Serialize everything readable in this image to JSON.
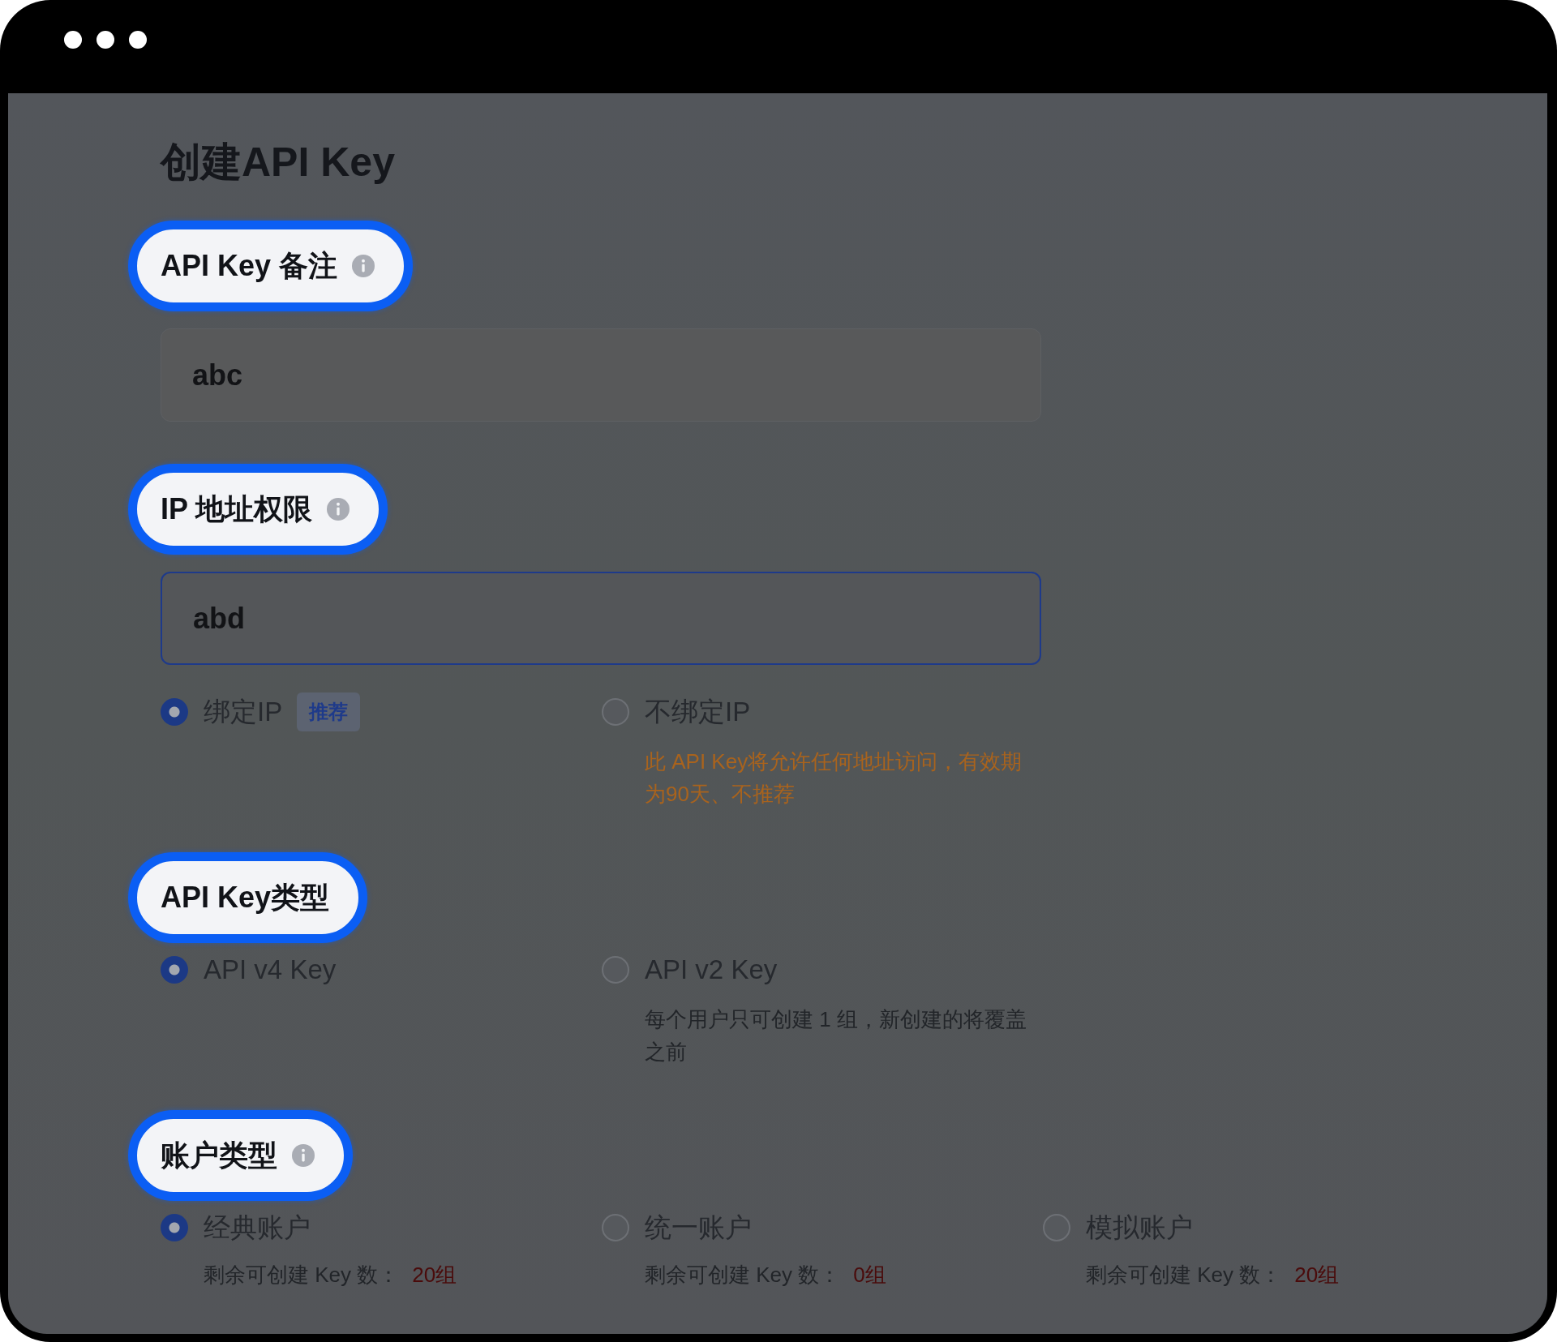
{
  "page": {
    "title": "创建API Key"
  },
  "sections": [
    {
      "label": {
        "text": "API Key 备注",
        "highlighted": true,
        "info": true
      },
      "field": {
        "value": "abc",
        "focused": false
      }
    },
    {
      "label": {
        "text": "IP 地址权限",
        "highlighted": true,
        "info": true
      },
      "field": {
        "value": "abd",
        "focused": true
      },
      "options": [
        {
          "label": "绑定IP",
          "selected": true,
          "badge": "推荐"
        },
        {
          "label": "不绑定IP",
          "selected": false,
          "note": {
            "kind": "warning",
            "text": "此 API Key将允许任何地址访问，有效期为90天、不推荐"
          }
        }
      ]
    },
    {
      "label": {
        "text": "API Key类型",
        "highlighted": true,
        "info": false
      },
      "options": [
        {
          "label": "API v4 Key",
          "selected": true
        },
        {
          "label": "API v2 Key",
          "selected": false,
          "note": {
            "kind": "hint",
            "text": "每个用户只可创建 1 组，新创建的将覆盖之前"
          }
        }
      ]
    },
    {
      "label": {
        "text": "账户类型",
        "highlighted": true,
        "info": true
      },
      "options": [
        {
          "label": "经典账户",
          "selected": true,
          "quota": {
            "label": "剩余可创建 Key 数：",
            "value": "20组"
          }
        },
        {
          "label": "统一账户",
          "selected": false,
          "quota": {
            "label": "剩余可创建 Key 数：",
            "value": "0组"
          }
        },
        {
          "label": "模拟账户",
          "selected": false,
          "quota": {
            "label": "剩余可创建 Key 数：",
            "value": "20组"
          }
        }
      ]
    }
  ]
}
